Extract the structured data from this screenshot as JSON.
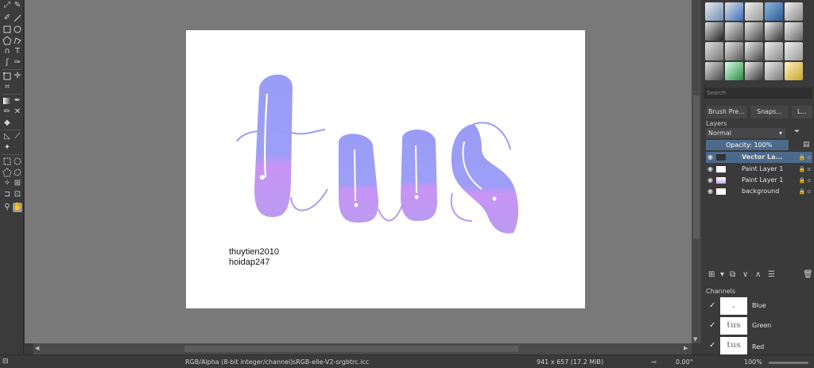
{
  "canvas": {
    "credit_line1": "thuytien2010",
    "credit_line2": "hoidap247",
    "artwork_text": "tus"
  },
  "brushes": {
    "search_placeholder": "Search",
    "tabs": [
      "Brush Pre...",
      "Snaps...",
      "L..."
    ]
  },
  "layers": {
    "title": "Layers",
    "blend_mode": "Normal",
    "opacity_label": "Opacity:",
    "opacity_value": "100%",
    "items": [
      {
        "name": "Vector La...",
        "selected": true
      },
      {
        "name": "Paint Layer 1",
        "selected": false
      },
      {
        "name": "Paint Layer 1",
        "selected": false
      },
      {
        "name": "background",
        "selected": false
      }
    ]
  },
  "channels": {
    "title": "Channels",
    "items": [
      {
        "name": "Blue",
        "thumb": "."
      },
      {
        "name": "Green",
        "thumb": "tus"
      },
      {
        "name": "Red",
        "thumb": "tus"
      }
    ]
  },
  "status": {
    "color_model": "RGB/Alpha (8-bit integer/channel)",
    "profile": "sRGB-elle-V2-srgbtrc.icc",
    "dimensions": "941 x 657 (17.2 MiB)",
    "rotation": "0.00°",
    "zoom": "100%"
  },
  "colors": {
    "gradient_top": "#9a9cf6",
    "gradient_bottom": "#c994f6",
    "selection": "#4d6a8a"
  }
}
